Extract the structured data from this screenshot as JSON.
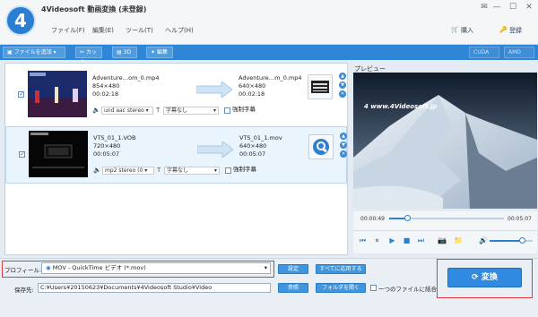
{
  "window": {
    "title": "4Videosoft 動画変換 (未登録)",
    "logo_text": "4"
  },
  "menu": [
    "ファイル(F)",
    "編集(E)",
    "ツール(T)",
    "ヘルプ(H)"
  ],
  "top_right": {
    "buy": "購入",
    "register": "登録"
  },
  "toolbar": {
    "add_file": "ファイルを追加",
    "cut": "カット",
    "3d": "3D",
    "edit": "編集",
    "cuda": "CUDA",
    "amd": "AMD"
  },
  "files": [
    {
      "src_name": "Adventure…om_0.mp4",
      "src_res": "854×480",
      "src_dur": "00:02:18",
      "out_name": "Adventure…m_0.mp4",
      "out_res": "640×480",
      "out_dur": "00:02:18",
      "audio": "und aac stereo",
      "subtitle": "字幕なし",
      "force_sub": "強制字幕"
    },
    {
      "src_name": "VTS_01_1.VOB",
      "src_res": "720×480",
      "src_dur": "00:05:07",
      "out_name": "VTS_01_1.mov",
      "out_res": "640×480",
      "out_dur": "00:05:07",
      "audio": "mp2 stereo (0",
      "subtitle": "字幕なし",
      "force_sub": "強制字幕"
    }
  ],
  "preview": {
    "label": "プレビュー",
    "watermark": "4 www.4Videosoft.jp",
    "current": "00:00:49",
    "total": "00:05:07",
    "progress": 0.16,
    "volume": 0.75
  },
  "bottom": {
    "profile_label": "プロフィール:",
    "profile_value": "MOV - QuickTime ビデオ (*.mov)",
    "settings": "設定",
    "apply_all": "すべてに応用する",
    "save_label": "保存先:",
    "save_path": "C:¥Users¥20150623¥Documents¥4Videosoft Studio¥Video",
    "browse": "参照",
    "open_folder": "フォルダを開く",
    "merge": "一つのファイルに結合",
    "convert": "変換"
  },
  "colors": {
    "accent": "#2f86d6",
    "highlight_border": "#e03a3a"
  }
}
